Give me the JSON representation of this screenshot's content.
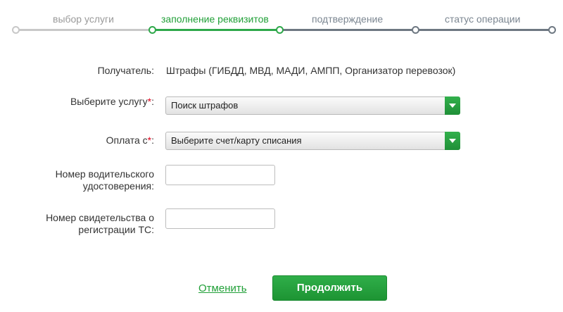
{
  "steps": [
    {
      "label": "выбор услуги",
      "state": "done"
    },
    {
      "label": "заполнение реквизитов",
      "state": "active"
    },
    {
      "label": "подтверждение",
      "state": "pending"
    },
    {
      "label": "статус операции",
      "state": "pending"
    }
  ],
  "form": {
    "recipient": {
      "label": "Получатель:",
      "value": "Штрафы (ГИБДД, МВД, МАДИ, АМПП, Организатор перевозок)"
    },
    "service": {
      "label": "Выберите услугу",
      "required_mark": "*",
      "colon": ":",
      "selected": "Поиск штрафов"
    },
    "payment_from": {
      "label": "Оплата с",
      "required_mark": "*",
      "colon": ":",
      "selected": "Выберите счет/карту списания"
    },
    "license": {
      "label_line1": "Номер водительского",
      "label_line2": "удостоверения:",
      "value": ""
    },
    "registration": {
      "label_line1": "Номер свидетельства о",
      "label_line2": "регистрации ТС:",
      "value": ""
    }
  },
  "actions": {
    "cancel_label": "Отменить",
    "submit_label": "Продолжить"
  },
  "colors": {
    "accent": "#21a038",
    "required": "#e0001a",
    "pending": "#6e7882",
    "done": "#c8c8c8"
  }
}
